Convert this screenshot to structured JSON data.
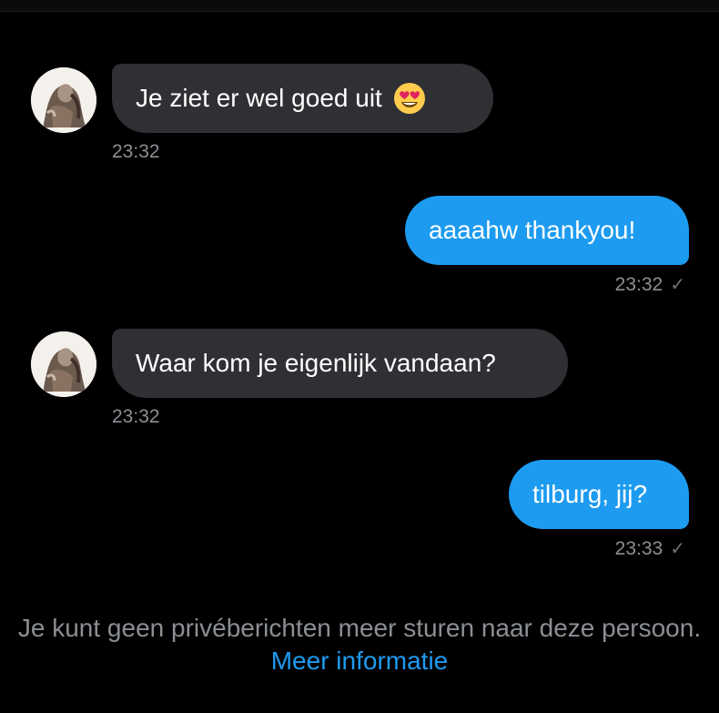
{
  "conversation": {
    "messages": [
      {
        "direction": "incoming",
        "text": "Je ziet er wel goed uit",
        "emoji": "heart-eyes-emoji",
        "time": "23:32"
      },
      {
        "direction": "outgoing",
        "text": "aaaahw thankyou!",
        "time": "23:32",
        "status": "sent-check-icon"
      },
      {
        "direction": "incoming",
        "text": "Waar kom je eigenlijk vandaan?",
        "time": "23:32"
      },
      {
        "direction": "outgoing",
        "text": "tilburg, jij?",
        "time": "23:33",
        "status": "sent-check-icon"
      }
    ]
  },
  "notice": {
    "text": "Je kunt geen privéberichten meer sturen naar deze persoon.",
    "link": "Meer informatie"
  },
  "colors": {
    "background": "#000000",
    "incoming_bubble": "#2f3034",
    "outgoing_bubble": "#1d9bf0",
    "timestamp": "#8b8f94",
    "link": "#1d9bf0"
  }
}
